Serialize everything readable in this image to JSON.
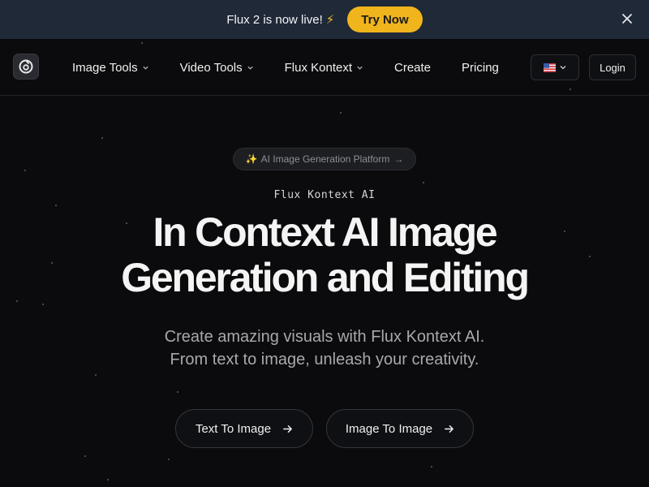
{
  "banner": {
    "text": "Flux 2 is now live!",
    "bolt": "⚡",
    "cta_label": "Try Now",
    "close_icon": "close-icon"
  },
  "nav": {
    "logo_icon": "logo-icon",
    "items": [
      {
        "label": "Image Tools",
        "has_dropdown": true
      },
      {
        "label": "Video Tools",
        "has_dropdown": true
      },
      {
        "label": "Flux Kontext",
        "has_dropdown": true
      },
      {
        "label": "Create",
        "has_dropdown": false
      },
      {
        "label": "Pricing",
        "has_dropdown": false
      }
    ],
    "language_icon": "us-flag-icon",
    "login_label": "Login"
  },
  "hero": {
    "badge_spark": "✨",
    "badge_text": "AI Image Generation Platform",
    "badge_arrow": "→",
    "eyebrow": "Flux Kontext AI",
    "headline_line1": "In Context AI Image",
    "headline_line2": "Generation and Editing",
    "sub_line1": "Create amazing visuals with Flux Kontext AI.",
    "sub_line2": "From text to image, unleash your creativity.",
    "cta_primary": "Text To Image",
    "cta_secondary": "Image To Image"
  },
  "colors": {
    "background": "#0b0b0d",
    "banner": "#1f2937",
    "accent": "#f0b41c"
  }
}
